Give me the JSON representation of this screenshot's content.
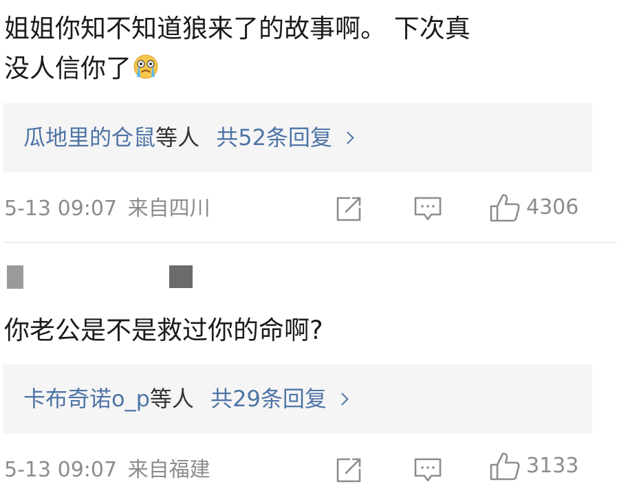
{
  "comment1": {
    "text_line1": "姐姐你知不知道狼来了的故事啊。 下次真",
    "text_line2": "没人信你了",
    "emoji": "crying-face",
    "replies": {
      "users": "瓜地里的仓鼠",
      "others": "等人",
      "count_text": "共52条回复"
    },
    "meta": {
      "time": "5-13 09:07",
      "location": "来自四川"
    },
    "likes": "4306"
  },
  "comment2": {
    "text": "你老公是不是救过你的命啊?",
    "replies": {
      "users": "卡布奇诺o_p",
      "others": "等人",
      "count_text": "共29条回复"
    },
    "meta": {
      "time": "5-13 09:07",
      "location": "来自福建"
    },
    "likes": "3133"
  },
  "colors": {
    "link": "#4e74a6",
    "meta": "#8c8c8c",
    "reply_bg": "#f5f5f5"
  },
  "icons": [
    "share-icon",
    "comment-icon",
    "like-icon",
    "chevron-right-icon",
    "crying-emoji"
  ]
}
